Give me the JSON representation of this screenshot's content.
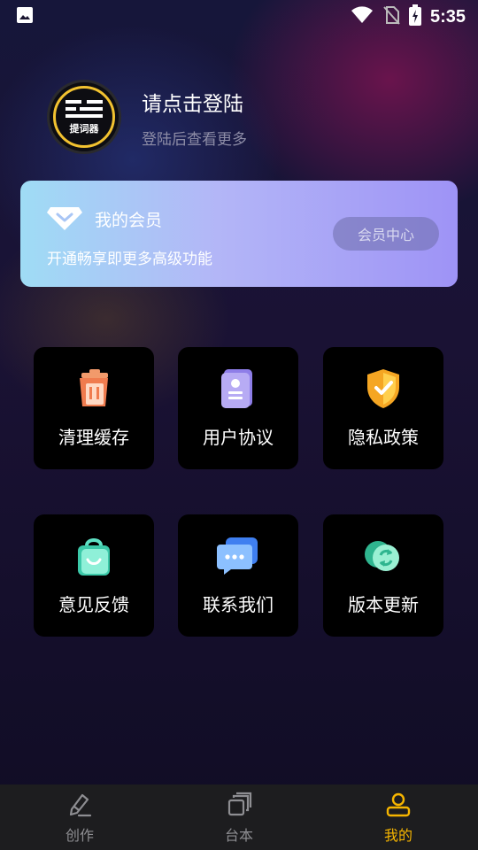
{
  "status_bar": {
    "time": "5:35"
  },
  "profile": {
    "avatar_text": "提词器",
    "title": "请点击登陆",
    "subtitle": "登陆后查看更多"
  },
  "member": {
    "title": "我的会员",
    "subtitle": "开通畅享即更多高级功能",
    "button": "会员中心"
  },
  "grid": [
    {
      "label": "清理缓存",
      "icon": "trash-icon"
    },
    {
      "label": "用户协议",
      "icon": "agreement-icon"
    },
    {
      "label": "隐私政策",
      "icon": "shield-icon"
    },
    {
      "label": "意见反馈",
      "icon": "feedback-bag-icon"
    },
    {
      "label": "联系我们",
      "icon": "chat-icon"
    },
    {
      "label": "版本更新",
      "icon": "update-icon"
    }
  ],
  "bottom_nav": [
    {
      "label": "创作",
      "icon": "pen-icon",
      "active": false
    },
    {
      "label": "台本",
      "icon": "script-icon",
      "active": false
    },
    {
      "label": "我的",
      "icon": "user-icon",
      "active": true
    }
  ],
  "colors": {
    "accent": "#f6b500",
    "inactive": "#8e8e92",
    "tile": "#000000"
  }
}
